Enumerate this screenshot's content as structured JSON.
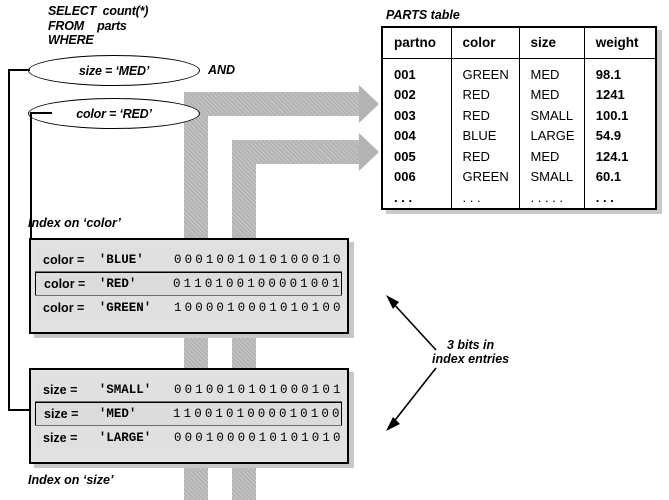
{
  "query": {
    "name": "sql-query",
    "text": "SELECT  count(*)\nFROM    parts\nWHERE"
  },
  "conditions": {
    "size_condition": "size = ‘MED’",
    "color_condition": "color = ‘RED’",
    "operator": "AND"
  },
  "parts_table": {
    "caption": "PARTS table",
    "columns": [
      "partno",
      "color",
      "size",
      "weight"
    ],
    "rows": [
      [
        "001",
        "GREEN",
        "MED",
        "98.1"
      ],
      [
        "002",
        "RED",
        "MED",
        "1241"
      ],
      [
        "003",
        "RED",
        "SMALL",
        "100.1"
      ],
      [
        "004",
        "BLUE",
        "LARGE",
        "54.9"
      ],
      [
        "005",
        "RED",
        "MED",
        "124.1"
      ],
      [
        "006",
        "GREEN",
        "SMALL",
        "60.1"
      ],
      [
        ". . .",
        ". . .",
        ". . . . .",
        ". . ."
      ]
    ]
  },
  "color_index": {
    "caption": "Index on ‘color’",
    "entries": [
      {
        "lhs": "color =",
        "value": "'BLUE'",
        "bits": "0001001010100010",
        "highlighted": false
      },
      {
        "lhs": "color =",
        "value": "'RED'",
        "bits": "0110100100001001",
        "highlighted": true
      },
      {
        "lhs": "color =",
        "value": "'GREEN'",
        "bits": "1000010001010100",
        "highlighted": false
      }
    ]
  },
  "size_index": {
    "caption": "Index on ‘size’",
    "entries": [
      {
        "lhs": "size =",
        "value": "'SMALL'",
        "bits": "0010010101000101",
        "highlighted": false
      },
      {
        "lhs": "size =",
        "value": "'MED'",
        "bits": "1100101000010100",
        "highlighted": true
      },
      {
        "lhs": "size =",
        "value": "'LARGE'",
        "bits": "0001000010101010",
        "highlighted": false
      }
    ]
  },
  "annotation": {
    "bits_note": "3 bits in\nindex entries"
  },
  "colors": {
    "band": "#b3b3b3",
    "index_bg": "#e2e2e2",
    "shadow": "#c7c7c7",
    "outline": "#000000"
  }
}
